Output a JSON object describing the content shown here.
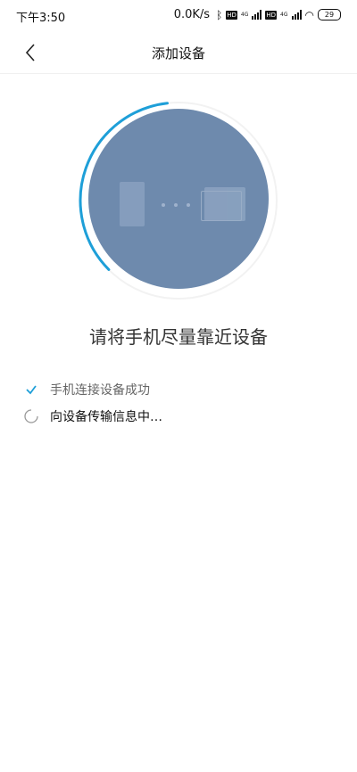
{
  "status_bar": {
    "time": "下午3:50",
    "net_speed": "0.0K/s",
    "sim1_label": "4G",
    "sim2_label": "4G",
    "hd_label": "HD",
    "battery": "29"
  },
  "nav": {
    "title": "添加设备"
  },
  "main": {
    "headline": "请将手机尽量靠近设备",
    "steps": [
      {
        "label": "手机连接设备成功",
        "state": "done"
      },
      {
        "label": "向设备传输信息中…",
        "state": "in-progress"
      }
    ]
  },
  "colors": {
    "accent": "#1e9fd8",
    "illustration_bg": "#6e8aad"
  },
  "icons": {
    "back": "chevron-left-icon",
    "check": "check-icon",
    "spinner": "loading-spinner-icon"
  }
}
